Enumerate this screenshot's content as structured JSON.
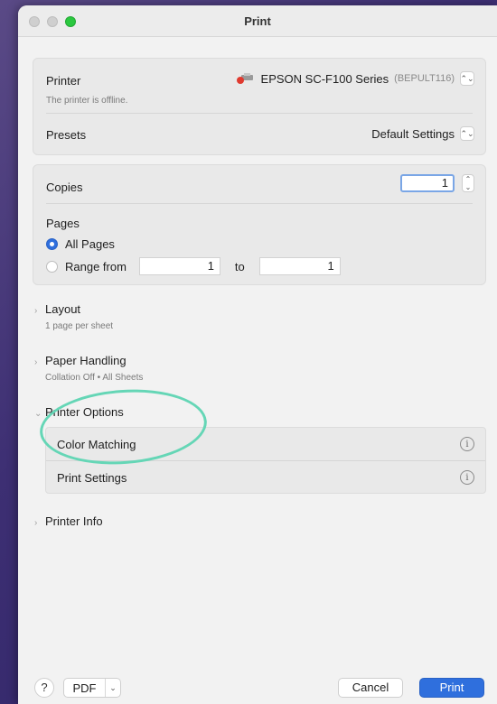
{
  "window": {
    "title": "Print"
  },
  "printer_panel": {
    "printer_label": "Printer",
    "printer_name": "EPSON SC-F100 Series",
    "printer_id": "(BEPULT116)",
    "printer_status": "The printer is offline.",
    "presets_label": "Presets",
    "presets_value": "Default Settings"
  },
  "copies_panel": {
    "copies_label": "Copies",
    "copies_value": "1",
    "pages_label": "Pages",
    "all_pages_label": "All Pages",
    "range_label": "Range from",
    "range_from": "1",
    "range_to_label": "to",
    "range_to": "1"
  },
  "sections": {
    "layout": {
      "title": "Layout",
      "subtitle": "1 page per sheet"
    },
    "paper_handling": {
      "title": "Paper Handling",
      "subtitle": "Collation Off • All Sheets"
    },
    "printer_options": {
      "title": "Printer Options"
    },
    "printer_info": {
      "title": "Printer Info"
    }
  },
  "printer_options": {
    "items": [
      {
        "label": "Color Matching",
        "icon": "info-icon"
      },
      {
        "label": "Print Settings",
        "icon": "info-icon"
      }
    ]
  },
  "footer": {
    "help_label": "?",
    "pdf_label": "PDF",
    "cancel_label": "Cancel",
    "print_label": "Print"
  },
  "colors": {
    "accent": "#2f6fdd",
    "highlight_circle": "#65d6b6",
    "offline_dot": "#e03a2f"
  }
}
